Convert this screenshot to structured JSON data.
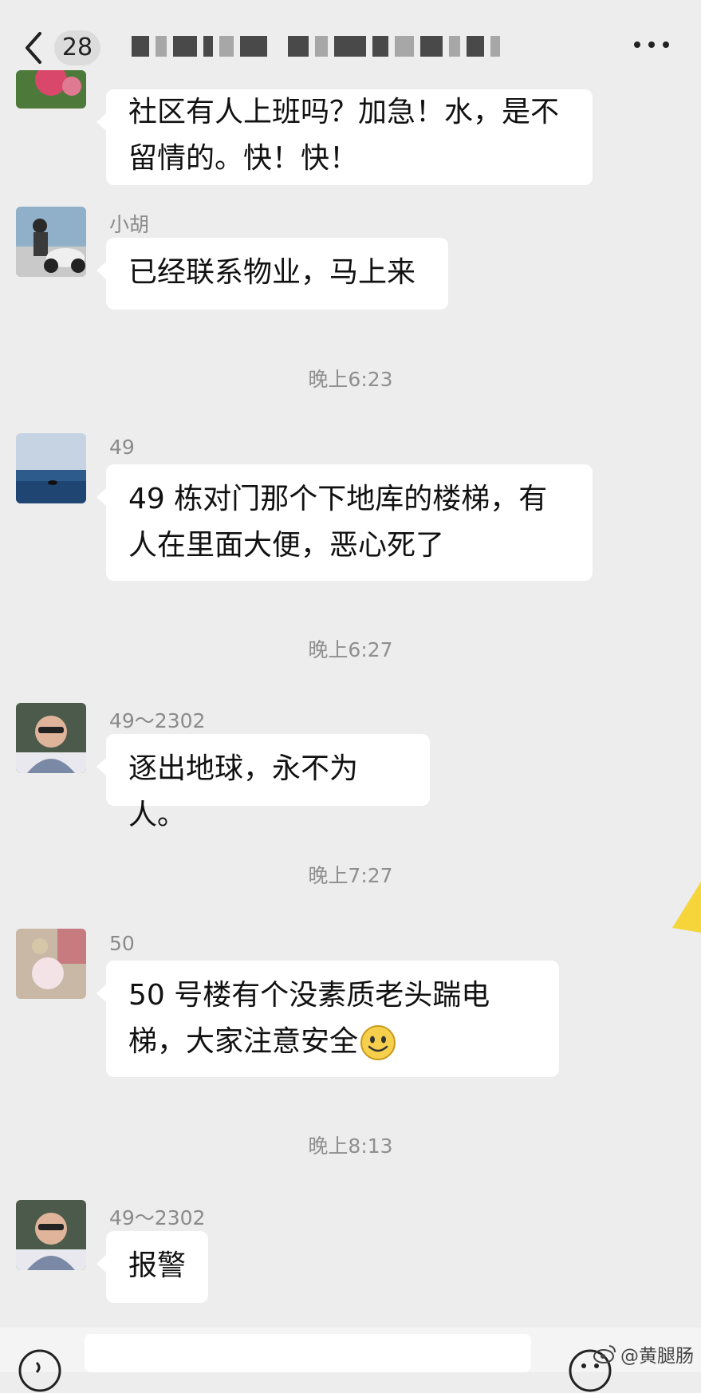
{
  "header": {
    "unread_count": "28",
    "title": "",
    "back_icon": "chevron-left-icon",
    "more_icon": "more-dots-icon"
  },
  "messages": [
    {
      "sender": "",
      "text": "社区有人上班吗？加急！水，是不留情的。快！快！"
    },
    {
      "sender": "小胡",
      "text": "已经联系物业，马上来"
    },
    {
      "time": "晚上6:23"
    },
    {
      "sender": "49",
      "text": "49 栋对门那个下地库的楼梯，有人在里面大便，恶心死了"
    },
    {
      "time": "晚上6:27"
    },
    {
      "sender": "49～2302",
      "text": "逐出地球，永不为人。"
    },
    {
      "time": "晚上7:27"
    },
    {
      "sender": "50",
      "text": "50 号楼有个没素质老头踹电梯，大家注意安全"
    },
    {
      "time": "晚上8:13"
    },
    {
      "sender": "49～2302",
      "text": "报警"
    }
  ],
  "footer": {
    "watermark": "@黄腿肠",
    "voice_icon": "voice-icon",
    "emoji_icon": "emoji-icon"
  },
  "colors": {
    "background": "#ededed",
    "bubble": "#ffffff",
    "time": "#8f8f8f",
    "sender": "#8a8a8a"
  }
}
